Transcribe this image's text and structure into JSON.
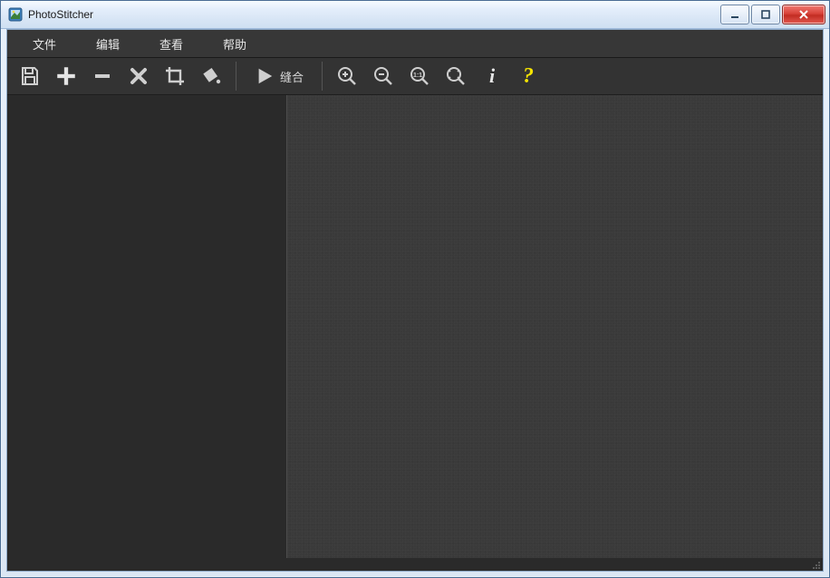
{
  "window": {
    "title": "PhotoStitcher"
  },
  "menu": {
    "file": "文件",
    "edit": "编辑",
    "view": "查看",
    "help": "帮助"
  },
  "toolbar": {
    "stitch_label": "缝合"
  },
  "icons": {
    "info_glyph": "i",
    "help_glyph": "?"
  }
}
